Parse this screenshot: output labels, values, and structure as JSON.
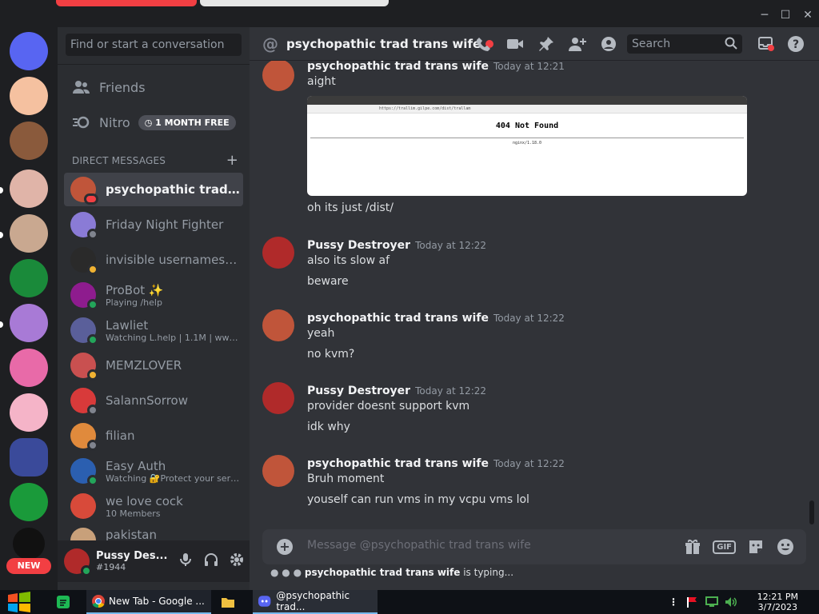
{
  "window": {
    "controls": [
      "─",
      "☐",
      "✕"
    ]
  },
  "rail": {
    "new_badge": "NEW"
  },
  "sidebar": {
    "search_placeholder": "Find or start a conversation",
    "friends_label": "Friends",
    "nitro_label": "Nitro",
    "nitro_badge": "1 MONTH FREE",
    "dm_header": "DIRECT MESSAGES",
    "dms": [
      {
        "name": "psychopathic trad tra...",
        "sub": "",
        "color": "#c0553a",
        "status": "#f23f43"
      },
      {
        "name": "Friday Night Fighter",
        "sub": "",
        "color": "#8a7bd6",
        "status": "#80848e"
      },
      {
        "name": "invisible usernames ar...",
        "sub": "",
        "color": "#2a2a2a",
        "status": "#f0b232"
      },
      {
        "name": "ProBot ✨",
        "sub": "Playing /help",
        "color": "#8e1c8e",
        "status": "#23a55a"
      },
      {
        "name": "Lawliet",
        "sub": "Watching L.help | 1.1M | www.l...",
        "color": "#5a5f9a",
        "status": "#23a55a"
      },
      {
        "name": "MEMZLOVER",
        "sub": "",
        "color": "#c95050",
        "status": "#f0b232"
      },
      {
        "name": "SalannSorrow",
        "sub": "",
        "color": "#d83a3a",
        "status": "#80848e"
      },
      {
        "name": "filian",
        "sub": "",
        "color": "#e08a3c",
        "status": "#80848e"
      },
      {
        "name": "Easy Auth",
        "sub": "Watching 🔐Protect your serv...",
        "color": "#2b5fb0",
        "status": "#23a55a"
      },
      {
        "name": "we love cock",
        "sub": "10 Members",
        "color": "#d84a3a",
        "status": ""
      }
    ],
    "partial_dm": "pakistan",
    "user": {
      "name": "Pussy Des...",
      "tag": "#1944"
    }
  },
  "header": {
    "title": "psychopathic trad trans wife",
    "search_placeholder": "Search"
  },
  "messages": [
    {
      "author": "psychopathic trad trans wife",
      "time": "Today at 12:21",
      "lines": [
        "aight",
        "oh its just /dist/"
      ],
      "has_image": true,
      "avatar_color": "#c0553a"
    },
    {
      "author": "Pussy Destroyer",
      "time": "Today at 12:22",
      "lines": [
        "also its slow af",
        "beware"
      ],
      "has_image": false,
      "avatar_color": "#b02a2a"
    },
    {
      "author": "psychopathic trad trans wife",
      "time": "Today at 12:22",
      "lines": [
        "yeah",
        "no kvm?"
      ],
      "has_image": false,
      "avatar_color": "#c0553a"
    },
    {
      "author": "Pussy Destroyer",
      "time": "Today at 12:22",
      "lines": [
        "provider doesnt support kvm",
        "idk why"
      ],
      "has_image": false,
      "avatar_color": "#b02a2a"
    },
    {
      "author": "psychopathic trad trans wife",
      "time": "Today at 12:22",
      "lines": [
        "Bruh moment",
        "youself can run vms in my vcpu vms lol"
      ],
      "has_image": false,
      "avatar_color": "#c0553a"
    }
  ],
  "embedded_image": {
    "url": "https://trallim.gilpe.com/dist/trallam",
    "heading": "404 Not Found",
    "server": "nginx/1.18.0"
  },
  "composer": {
    "placeholder": "Message @psychopathic trad trans wife",
    "gif_label": "GIF",
    "typing_user": "psychopathic trad trans wife",
    "typing_suffix": " is typing..."
  },
  "taskbar": {
    "chrome_label": "New Tab - Google ...",
    "discord_label": "@psychopathic trad...",
    "time": "12:21 PM",
    "date": "3/7/2023"
  }
}
